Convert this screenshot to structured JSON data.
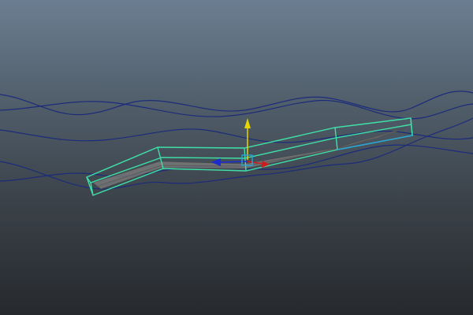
{
  "viewport": {
    "name": "3d-viewport",
    "background_top": "#6b7e91",
    "background_bottom": "#26292d"
  },
  "colors": {
    "curves": "#1c2b7a",
    "selection_outline": "#3fe0a8",
    "selection_outline_edge": "#2aa3d8",
    "mesh_fill": "#7d7d7d",
    "axis_y": "#e8d400",
    "axis_x": "#d01c1c",
    "axis_z": "#1c2bd0",
    "manipulator_center": "#2aa3d8"
  },
  "objects": [
    {
      "name": "flat-strip-mesh",
      "type": "mesh",
      "selected": true
    },
    {
      "name": "nurbs-curve",
      "type": "curve",
      "count": 4
    }
  ],
  "manipulator": {
    "type": "move-tool",
    "axes": [
      "y",
      "x",
      "z"
    ]
  }
}
